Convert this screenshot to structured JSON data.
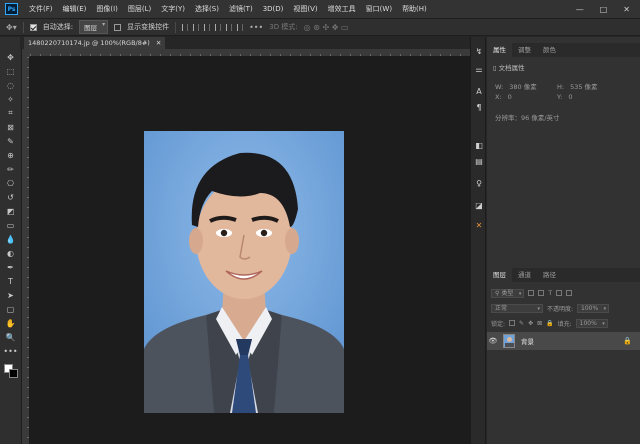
{
  "menu": {
    "logo": "Ps",
    "items": [
      "文件(F)",
      "编辑(E)",
      "图像(I)",
      "图层(L)",
      "文字(Y)",
      "选择(S)",
      "滤镜(T)",
      "3D(D)",
      "视图(V)",
      "增效工具",
      "窗口(W)",
      "帮助(H)"
    ],
    "window_controls": [
      "—",
      "□",
      "✕"
    ]
  },
  "options": {
    "auto_select_label": "自动选择:",
    "auto_select_target": "图层",
    "show_transform_label": "显示变换控件",
    "mode_3d_label": "3D 模式:",
    "more": "•••"
  },
  "document": {
    "tab_title": "1480220710174.jp @ 100%(RGB/8#)",
    "close": "✕"
  },
  "toolbar": {
    "tools": [
      "move-icon",
      "marquee-icon",
      "lasso-icon",
      "magic-wand-icon",
      "crop-icon",
      "frame-icon",
      "eyedropper-icon",
      "healing-icon",
      "brush-icon",
      "stamp-icon",
      "history-brush-icon",
      "eraser-icon",
      "gradient-icon",
      "blur-icon",
      "dodge-icon",
      "pen-icon",
      "type-icon",
      "path-select-icon",
      "rectangle-icon",
      "hand-icon",
      "zoom-icon",
      "more-icon"
    ],
    "glyphs": [
      "✥",
      "⬚",
      "◌",
      "✧",
      "⌗",
      "⊠",
      "✎",
      "⊕",
      "✏",
      "⎔",
      "↺",
      "◩",
      "▭",
      "💧",
      "◐",
      "✒",
      "T",
      "➤",
      "▢",
      "✋",
      "🔍",
      "•••"
    ]
  },
  "properties": {
    "tabs": [
      "属性",
      "调整",
      "颜色"
    ],
    "section_title": "文档属性",
    "w_label": "W:",
    "w_value": "380 像素",
    "h_label": "H:",
    "h_value": "535 像素",
    "x_label": "X:",
    "x_value": "0",
    "y_label": "Y:",
    "y_value": "0",
    "resolution": "分辨率：96 像素/英寸"
  },
  "layers": {
    "tabs": [
      "图层",
      "通道",
      "路径"
    ],
    "filter_label": "类型",
    "blend_mode": "正常",
    "opacity_label": "不透明度:",
    "opacity_value": "100%",
    "lock_label": "锁定:",
    "fill_label": "填充:",
    "fill_value": "100%",
    "items": [
      {
        "name": "背景",
        "visible": true,
        "locked": true
      }
    ]
  },
  "colors": {
    "photo_background": "#6ea2d9",
    "accent_orange": "#e8913a",
    "ps_blue": "#31a8ff"
  }
}
